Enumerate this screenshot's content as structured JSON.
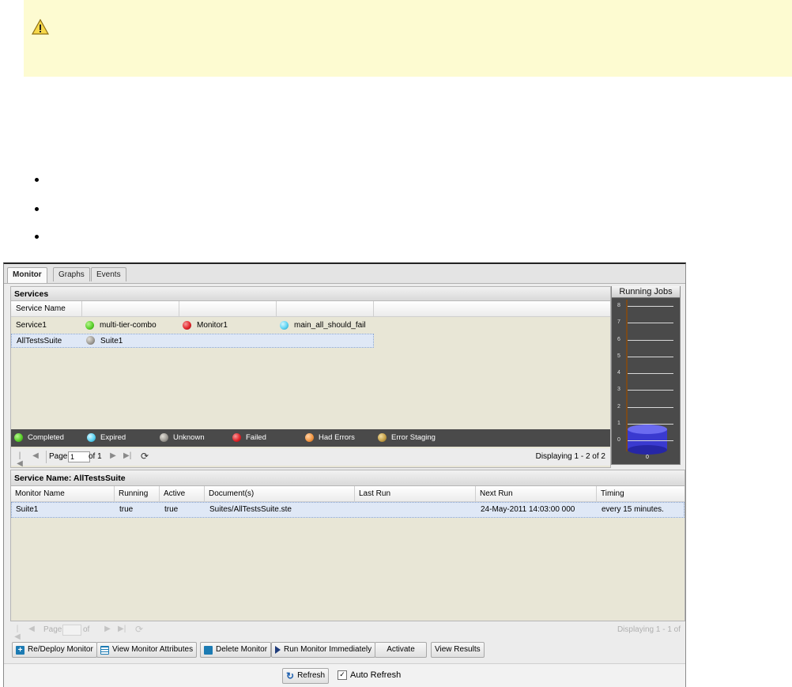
{
  "tabs": [
    {
      "label": "Monitor"
    },
    {
      "label": "Graphs"
    },
    {
      "label": "Events"
    }
  ],
  "services": {
    "title": "Services",
    "columns": [
      "Service Name"
    ],
    "rows": [
      {
        "name": "Service1",
        "monitors": [
          {
            "label": "multi-tier-combo",
            "status": "Completed"
          },
          {
            "label": "Monitor1",
            "status": "Failed"
          },
          {
            "label": "main_all_should_fail",
            "status": "Expired"
          }
        ]
      },
      {
        "name": "AllTestsSuite",
        "monitors": [
          {
            "label": "Suite1",
            "status": "Unknown"
          }
        ]
      }
    ],
    "legend": [
      {
        "label": "Completed",
        "color": "#5bd12c"
      },
      {
        "label": "Expired",
        "color": "#5fd4f3"
      },
      {
        "label": "Unknown",
        "color": "#a09d97"
      },
      {
        "label": "Failed",
        "color": "#e3262b"
      },
      {
        "label": "Had Errors",
        "color": "#f59a47"
      },
      {
        "label": "Error Staging",
        "color": "#c7a24a"
      }
    ],
    "pager": {
      "page_label": "Page",
      "page_value": "1",
      "of_label": "of 1",
      "display": "Displaying 1 - 2 of 2"
    }
  },
  "jobs_chart": {
    "title": "Running Jobs",
    "ticks": [
      "8",
      "7",
      "6",
      "5",
      "4",
      "3",
      "2",
      "1",
      "0"
    ],
    "value_label": "0",
    "ylim": [
      0,
      8
    ],
    "value": 0
  },
  "detail": {
    "title": "Service Name: AllTestsSuite",
    "columns": [
      "Monitor Name",
      "Running",
      "Active",
      "Document(s)",
      "Last Run",
      "Next Run",
      "Timing"
    ],
    "rows": [
      {
        "monitor": "Suite1",
        "running": "true",
        "active": "true",
        "document": "Suites/AllTestsSuite.ste",
        "last_run": "",
        "next_run": "24-May-2011 14:03:00 000",
        "timing": "every 15 minutes."
      }
    ],
    "pager": {
      "page_label": "Page",
      "of_label": "of",
      "display": "Displaying 1 - 1 of"
    }
  },
  "toolbar": {
    "redeploy": "Re/Deploy Monitor",
    "view_attrs": "View Monitor Attributes",
    "delete": "Delete Monitor",
    "run_now": "Run Monitor Immediately",
    "activate": "Activate",
    "view_results": "View Results"
  },
  "footer": {
    "refresh": "Refresh",
    "auto_refresh": "Auto Refresh",
    "auto_refresh_checked": true
  },
  "colors": {
    "warning_bg": "#fdfbd1",
    "panel_bg": "#e8e6d6",
    "legend_bg": "#4a4a4a",
    "selection_bg": "#dfe8f6"
  }
}
